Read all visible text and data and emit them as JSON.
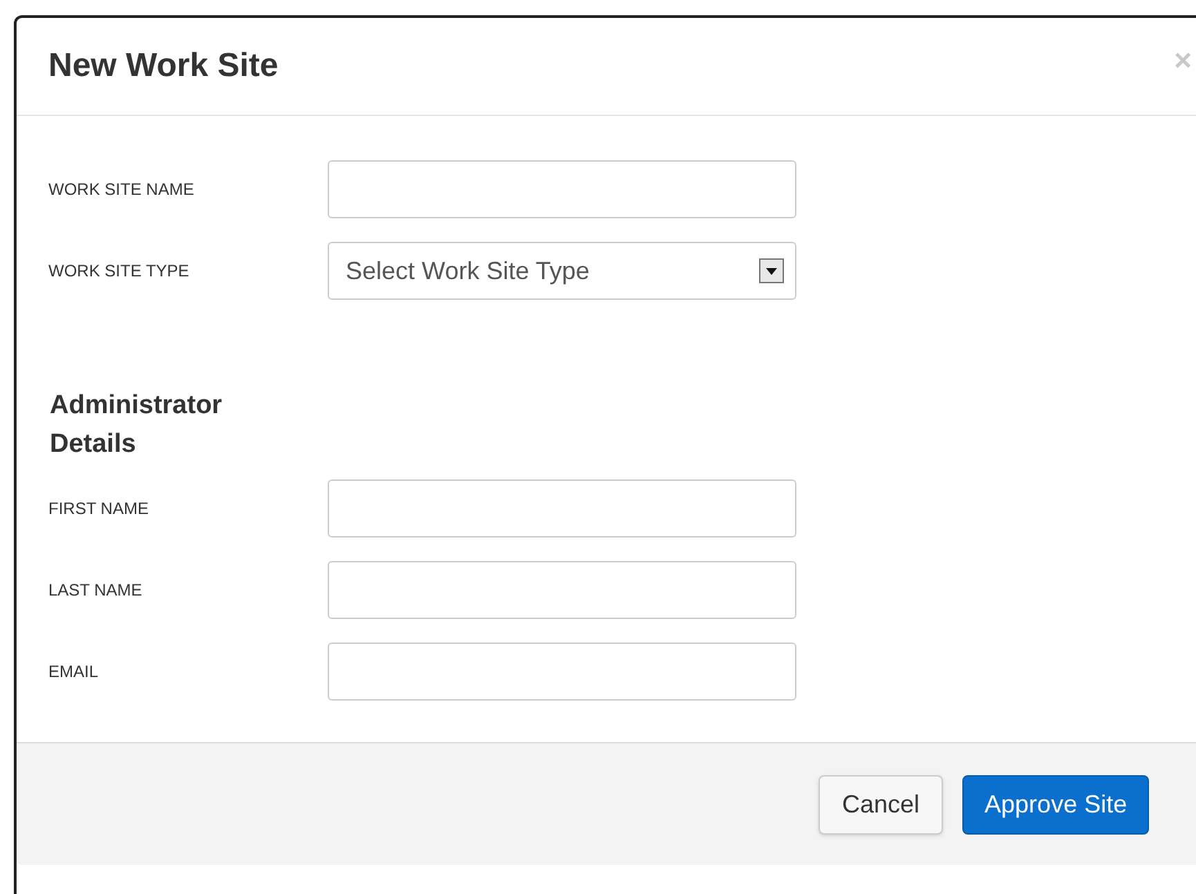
{
  "dialog": {
    "title": "New Work Site",
    "close": "×",
    "site_fields": [
      {
        "label": "WORK SITE NAME",
        "kind": "text"
      },
      {
        "label": "WORK SITE TYPE",
        "kind": "select",
        "placeholder": "Select Work Site Type"
      }
    ],
    "section_heading": "Administrator Details",
    "admin_fields": [
      {
        "label": "FIRST NAME",
        "kind": "text"
      },
      {
        "label": "LAST NAME",
        "kind": "text"
      },
      {
        "label": "EMAIL",
        "kind": "text"
      }
    ],
    "buttons": [
      {
        "label": "Cancel",
        "kind": "default"
      },
      {
        "label": "Approve Site",
        "kind": "primary"
      }
    ]
  }
}
